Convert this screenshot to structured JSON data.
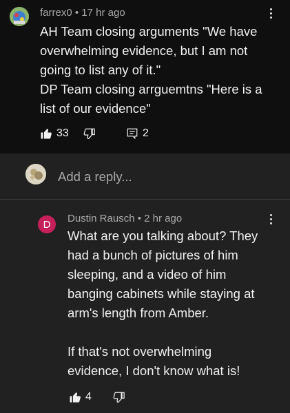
{
  "comment": {
    "author": "farrex0",
    "separator": "•",
    "time": "17 hr ago",
    "lines": [
      "AH Team closing arguments \"We have",
      "overwhelming evidence, but I am not",
      "going to list any of it.\"",
      "DP Team closing arrguemtns \"Here is a",
      "list of our evidence\""
    ],
    "likes": "33",
    "replies": "2"
  },
  "reply_box": {
    "placeholder": "Add a reply..."
  },
  "reply": {
    "avatar_letter": "D",
    "author": "Dustin Rausch",
    "separator": "•",
    "time": "2 hr ago",
    "lines": [
      "What are you talking about? They",
      "had a bunch of pictures of him",
      "sleeping, and a video of him",
      "banging cabinets while staying at",
      "arm's length from Amber.",
      "",
      "If that's not overwhelming",
      "evidence, I don't know what is!"
    ],
    "likes": "4"
  },
  "colors": {
    "background": "#212121",
    "comment_background": "#0f0f0f",
    "avatar_d": "#c6205a"
  }
}
